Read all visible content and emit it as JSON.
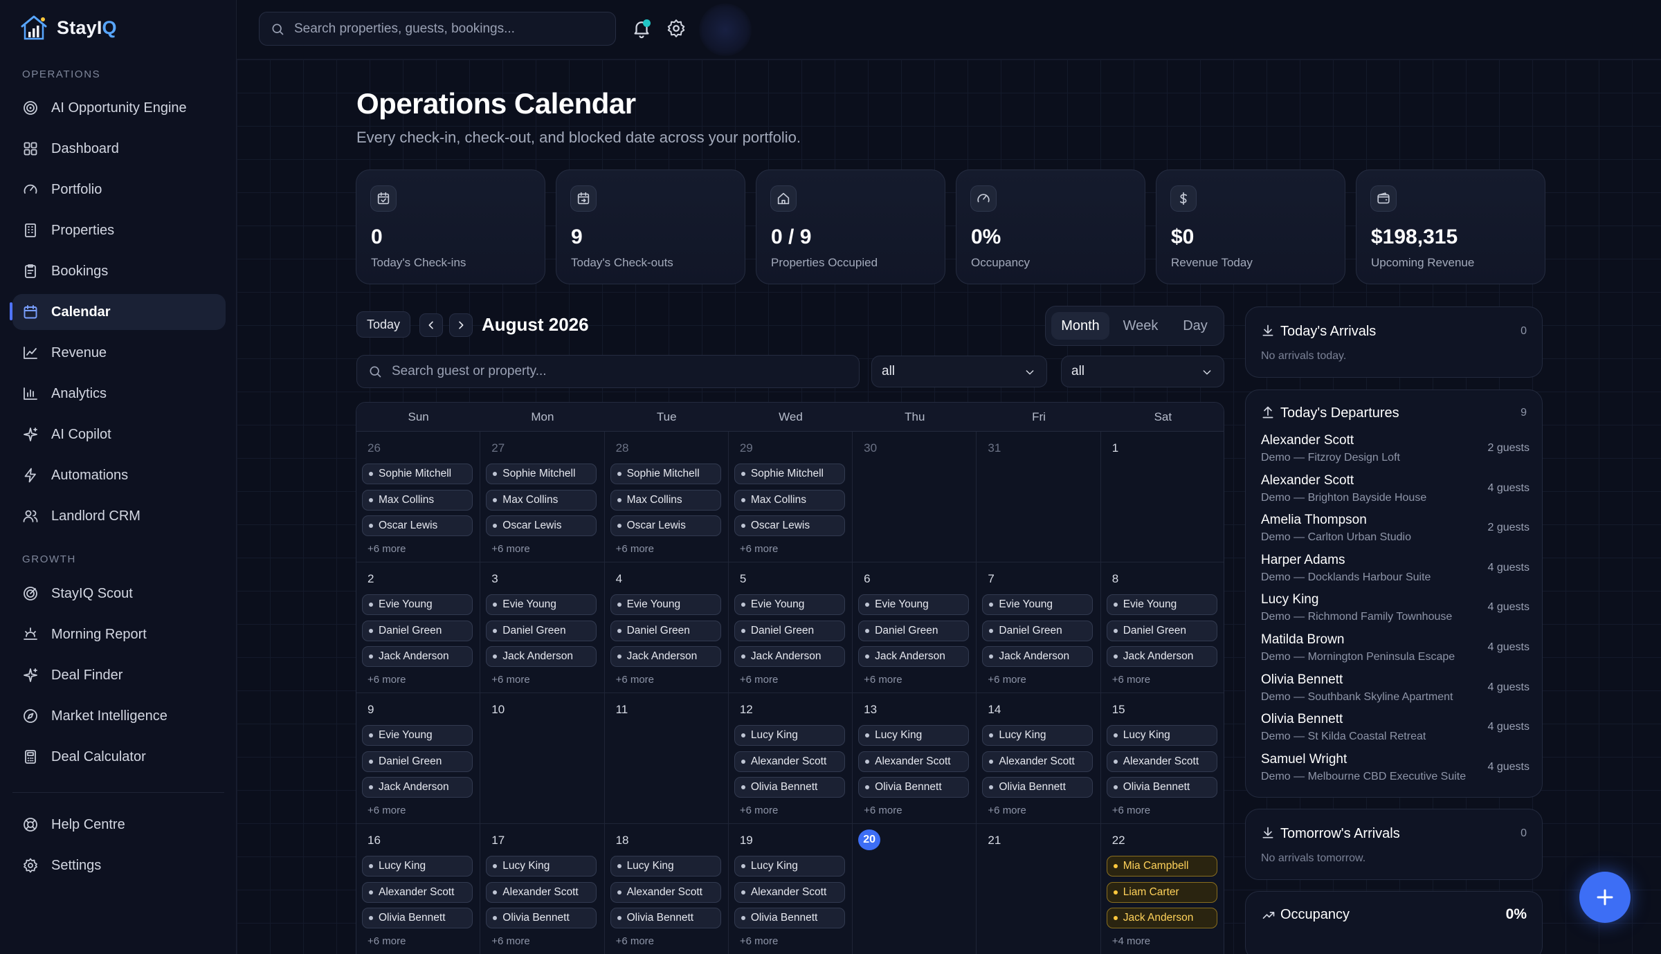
{
  "brand": {
    "name_main": "StayI",
    "name_accent": "Q"
  },
  "sidebar": {
    "operations_label": "OPERATIONS",
    "growth_label": "GROWTH",
    "operations": [
      {
        "label": "AI Opportunity Engine",
        "icon": "target-icon"
      },
      {
        "label": "Dashboard",
        "icon": "grid-icon"
      },
      {
        "label": "Portfolio",
        "icon": "gauge-icon"
      },
      {
        "label": "Properties",
        "icon": "building-icon"
      },
      {
        "label": "Bookings",
        "icon": "clipboard-icon"
      },
      {
        "label": "Calendar",
        "icon": "calendar-icon",
        "active": true
      },
      {
        "label": "Revenue",
        "icon": "trend-icon"
      },
      {
        "label": "Analytics",
        "icon": "bar-chart-icon"
      },
      {
        "label": "AI Copilot",
        "icon": "sparkle-icon"
      },
      {
        "label": "Automations",
        "icon": "bolt-icon"
      },
      {
        "label": "Landlord CRM",
        "icon": "users-icon"
      }
    ],
    "growth": [
      {
        "label": "StayIQ Scout",
        "icon": "radar-icon"
      },
      {
        "label": "Morning Report",
        "icon": "sunrise-icon"
      },
      {
        "label": "Deal Finder",
        "icon": "sparkle-icon"
      },
      {
        "label": "Market Intelligence",
        "icon": "compass-icon"
      },
      {
        "label": "Deal Calculator",
        "icon": "calculator-icon"
      }
    ],
    "footer": [
      {
        "label": "Help Centre",
        "icon": "lifebuoy-icon"
      },
      {
        "label": "Settings",
        "icon": "gear-icon"
      }
    ]
  },
  "topbar": {
    "search_placeholder": "Search properties, guests, bookings..."
  },
  "page": {
    "title": "Operations Calendar",
    "subtitle": "Every check-in, check-out, and blocked date across your portfolio."
  },
  "stats": [
    {
      "value": "0",
      "label": "Today's Check-ins",
      "icon": "calendar-in-icon"
    },
    {
      "value": "9",
      "label": "Today's Check-outs",
      "icon": "calendar-out-icon"
    },
    {
      "value": "0 / 9",
      "label": "Properties Occupied",
      "icon": "home-icon"
    },
    {
      "value": "0%",
      "label": "Occupancy",
      "icon": "gauge-icon"
    },
    {
      "value": "$0",
      "label": "Revenue Today",
      "icon": "dollar-icon"
    },
    {
      "value": "$198,315",
      "label": "Upcoming Revenue",
      "icon": "wallet-icon"
    }
  ],
  "calendar": {
    "today_label": "Today",
    "month_label": "August 2026",
    "views": [
      "Month",
      "Week",
      "Day"
    ],
    "selected_view": "Month",
    "guest_search_placeholder": "Search guest or property...",
    "filter1": "all",
    "filter2": "all",
    "weekdays": [
      "Sun",
      "Mon",
      "Tue",
      "Wed",
      "Thu",
      "Fri",
      "Sat"
    ],
    "weeks": [
      [
        {
          "day": "26",
          "dim": true,
          "events": [
            "Sophie Mitchell",
            "Max Collins",
            "Oscar Lewis"
          ],
          "more": "+6 more"
        },
        {
          "day": "27",
          "dim": true,
          "events": [
            "Sophie Mitchell",
            "Max Collins",
            "Oscar Lewis"
          ],
          "more": "+6 more"
        },
        {
          "day": "28",
          "dim": true,
          "events": [
            "Sophie Mitchell",
            "Max Collins",
            "Oscar Lewis"
          ],
          "more": "+6 more"
        },
        {
          "day": "29",
          "dim": true,
          "events": [
            "Sophie Mitchell",
            "Max Collins",
            "Oscar Lewis"
          ],
          "more": "+6 more"
        },
        {
          "day": "30",
          "dim": true,
          "events": [],
          "more": ""
        },
        {
          "day": "31",
          "dim": true,
          "events": [],
          "more": ""
        },
        {
          "day": "1",
          "events": [],
          "more": ""
        }
      ],
      [
        {
          "day": "2",
          "events": [
            "Evie Young",
            "Daniel Green",
            "Jack Anderson"
          ],
          "more": "+6 more"
        },
        {
          "day": "3",
          "events": [
            "Evie Young",
            "Daniel Green",
            "Jack Anderson"
          ],
          "more": "+6 more"
        },
        {
          "day": "4",
          "events": [
            "Evie Young",
            "Daniel Green",
            "Jack Anderson"
          ],
          "more": "+6 more"
        },
        {
          "day": "5",
          "events": [
            "Evie Young",
            "Daniel Green",
            "Jack Anderson"
          ],
          "more": "+6 more"
        },
        {
          "day": "6",
          "events": [
            "Evie Young",
            "Daniel Green",
            "Jack Anderson"
          ],
          "more": "+6 more"
        },
        {
          "day": "7",
          "events": [
            "Evie Young",
            "Daniel Green",
            "Jack Anderson"
          ],
          "more": "+6 more"
        },
        {
          "day": "8",
          "events": [
            "Evie Young",
            "Daniel Green",
            "Jack Anderson"
          ],
          "more": "+6 more"
        }
      ],
      [
        {
          "day": "9",
          "events": [
            "Evie Young",
            "Daniel Green",
            "Jack Anderson"
          ],
          "more": "+6 more"
        },
        {
          "day": "10",
          "events": [],
          "more": ""
        },
        {
          "day": "11",
          "events": [],
          "more": ""
        },
        {
          "day": "12",
          "events": [
            "Lucy King",
            "Alexander Scott",
            "Olivia Bennett"
          ],
          "more": "+6 more"
        },
        {
          "day": "13",
          "events": [
            "Lucy King",
            "Alexander Scott",
            "Olivia Bennett"
          ],
          "more": "+6 more"
        },
        {
          "day": "14",
          "events": [
            "Lucy King",
            "Alexander Scott",
            "Olivia Bennett"
          ],
          "more": "+6 more"
        },
        {
          "day": "15",
          "events": [
            "Lucy King",
            "Alexander Scott",
            "Olivia Bennett"
          ],
          "more": "+6 more"
        }
      ],
      [
        {
          "day": "16",
          "events": [
            "Lucy King",
            "Alexander Scott",
            "Olivia Bennett"
          ],
          "more": "+6 more"
        },
        {
          "day": "17",
          "events": [
            "Lucy King",
            "Alexander Scott",
            "Olivia Bennett"
          ],
          "more": "+6 more"
        },
        {
          "day": "18",
          "events": [
            "Lucy King",
            "Alexander Scott",
            "Olivia Bennett"
          ],
          "more": "+6 more"
        },
        {
          "day": "19",
          "events": [
            "Lucy King",
            "Alexander Scott",
            "Olivia Bennett"
          ],
          "more": "+6 more"
        },
        {
          "day": "20",
          "today": true,
          "events": [],
          "more": ""
        },
        {
          "day": "21",
          "events": [],
          "more": ""
        },
        {
          "day": "22",
          "gold": true,
          "events": [
            "Mia Campbell",
            "Liam Carter",
            "Jack Anderson"
          ],
          "more": "+4 more"
        }
      ]
    ]
  },
  "arrivals": {
    "title": "Today's Arrivals",
    "count": "0",
    "empty": "No arrivals today."
  },
  "departures": {
    "title": "Today's Departures",
    "count": "9",
    "items": [
      {
        "name": "Alexander Scott",
        "property": "Demo — Fitzroy Design Loft",
        "guests": "2 guests"
      },
      {
        "name": "Alexander Scott",
        "property": "Demo — Brighton Bayside House",
        "guests": "4 guests"
      },
      {
        "name": "Amelia Thompson",
        "property": "Demo — Carlton Urban Studio",
        "guests": "2 guests"
      },
      {
        "name": "Harper Adams",
        "property": "Demo — Docklands Harbour Suite",
        "guests": "4 guests"
      },
      {
        "name": "Lucy King",
        "property": "Demo — Richmond Family Townhouse",
        "guests": "4 guests"
      },
      {
        "name": "Matilda Brown",
        "property": "Demo — Mornington Peninsula Escape",
        "guests": "4 guests"
      },
      {
        "name": "Olivia Bennett",
        "property": "Demo — Southbank Skyline Apartment",
        "guests": "4 guests"
      },
      {
        "name": "Olivia Bennett",
        "property": "Demo — St Kilda Coastal Retreat",
        "guests": "4 guests"
      },
      {
        "name": "Samuel Wright",
        "property": "Demo — Melbourne CBD Executive Suite",
        "guests": "4 guests"
      }
    ]
  },
  "tomorrow": {
    "title": "Tomorrow's Arrivals",
    "count": "0",
    "empty": "No arrivals tomorrow."
  },
  "occupancy": {
    "title": "Occupancy",
    "value": "0%"
  },
  "colors": {
    "accent": "#3d6ef5",
    "brand_accent": "#58a6ff",
    "gold": "#ffc83d",
    "teal": "#21c6c6"
  }
}
